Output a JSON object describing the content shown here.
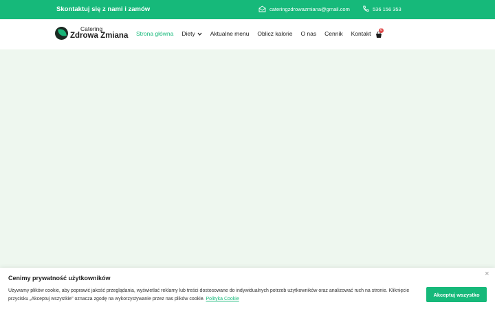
{
  "topbar": {
    "tagline": "Skontaktuj się z nami i zamów",
    "email": "cateringzdrowazmiana@gmail.com",
    "phone": "536 156 353",
    "email_icon": "mail-icon",
    "phone_icon": "phone-icon",
    "background_color": "#16b97a"
  },
  "logo": {
    "line1": "Catering",
    "line2": "Zdrowa Zmiana",
    "icon": "leaf-icon"
  },
  "nav": {
    "items": [
      {
        "label": "Strona główna",
        "active": true
      },
      {
        "label": "Diety",
        "has_dropdown": true
      },
      {
        "label": "Aktualne menu"
      },
      {
        "label": "Oblicz kalorie"
      },
      {
        "label": "O nas"
      },
      {
        "label": "Cennik"
      },
      {
        "label": "Kontakt"
      }
    ],
    "active_color": "#16b97a"
  },
  "cart": {
    "icon": "cart-icon",
    "count": "0"
  },
  "cookie_banner": {
    "title": "Cenimy prywatność użytkowników",
    "text": "Używamy plików cookie, aby poprawić jakość przeglądania, wyświetlać reklamy lub treści dostosowane do indywidualnych potrzeb użytkowników oraz analizować ruch na stronie. Kliknięcie przycisku „Akceptuj wszystkie” oznacza zgodę na wykorzystywanie przez nas plików cookie.",
    "policy_link": "Polityka Cookie",
    "accept_button": "Akceptuj wszystko",
    "close_icon": "close-icon"
  }
}
